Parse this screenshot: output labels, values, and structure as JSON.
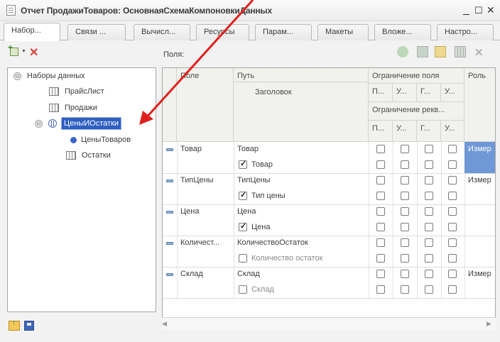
{
  "window": {
    "title": "Отчет ПродажиТоваров: ОсновнаяСхемаКомпоновкиДанных",
    "minimize": "_",
    "maximize": "☐",
    "close": "✕"
  },
  "tabs": [
    {
      "label": "Набор..."
    },
    {
      "label": "Связи ..."
    },
    {
      "label": "Вычисл..."
    },
    {
      "label": "Ресурсы"
    },
    {
      "label": "Парам..."
    },
    {
      "label": "Макеты"
    },
    {
      "label": "Вложе..."
    },
    {
      "label": "Настро..."
    }
  ],
  "left_toolbar": {
    "add_dropdown": "▼",
    "delete": "✕"
  },
  "tree": {
    "root": {
      "toggle": "⊖",
      "label": "Наборы данных"
    },
    "items": [
      {
        "label": "ПрайсЛист",
        "type": "table"
      },
      {
        "label": "Продажи",
        "type": "table"
      },
      {
        "label": "ЦеныИОстатки",
        "type": "union",
        "toggle": "⊖",
        "selected": true
      },
      {
        "label": "ЦеныТоваров",
        "type": "query"
      },
      {
        "label": "Остатки",
        "type": "table"
      }
    ]
  },
  "fields_panel": {
    "label": "Поля:",
    "toolbar_delete": "✕"
  },
  "grid": {
    "headers": {
      "field": "Поле",
      "path": "Путь",
      "caption": "Заголовок",
      "field_restriction": "Ограничение поля",
      "attr_restriction": "Ограничение рекв...",
      "role": "Роль",
      "sub_a": [
        "П...",
        "У...",
        "Г...",
        "У..."
      ],
      "sub_b": [
        "П...",
        "У...",
        "Г...",
        "У..."
      ]
    },
    "rows": [
      {
        "field": "Товар",
        "path": "Товар",
        "caption": "Товар",
        "caption_checked": true,
        "field_checks": [
          false,
          false,
          false,
          false
        ],
        "attr_checks": [
          false,
          false,
          false,
          false
        ],
        "role": "Измер"
      },
      {
        "field": "ТипЦены",
        "path": "ТипЦены",
        "caption": "Тип цены",
        "caption_checked": true,
        "field_checks": [
          false,
          false,
          false,
          false
        ],
        "attr_checks": [
          false,
          false,
          false,
          false
        ],
        "role": "Измер"
      },
      {
        "field": "Цена",
        "path": "Цена",
        "caption": "Цена",
        "caption_checked": true,
        "field_checks": [
          false,
          false,
          false,
          false
        ],
        "attr_checks": [
          false,
          false,
          false,
          false
        ],
        "role": ""
      },
      {
        "field": "Количест...",
        "path": "КоличествоОстаток",
        "caption": "Количество остаток",
        "caption_checked": false,
        "field_checks": [
          false,
          false,
          false,
          false
        ],
        "attr_checks": [
          false,
          false,
          false,
          false
        ],
        "role": ""
      },
      {
        "field": "Склад",
        "path": "Склад",
        "caption": "Склад",
        "caption_checked": false,
        "field_checks": [
          false,
          false,
          false,
          false
        ],
        "attr_checks": [
          false,
          false,
          false,
          false
        ],
        "role": "Измер"
      }
    ]
  },
  "scrollbar": {
    "left": "◀",
    "right": "▶"
  },
  "colors": {
    "selection": "#2f5fc0",
    "role_selection": "#6f98d6",
    "annotation_arrow": "#e0201c"
  }
}
